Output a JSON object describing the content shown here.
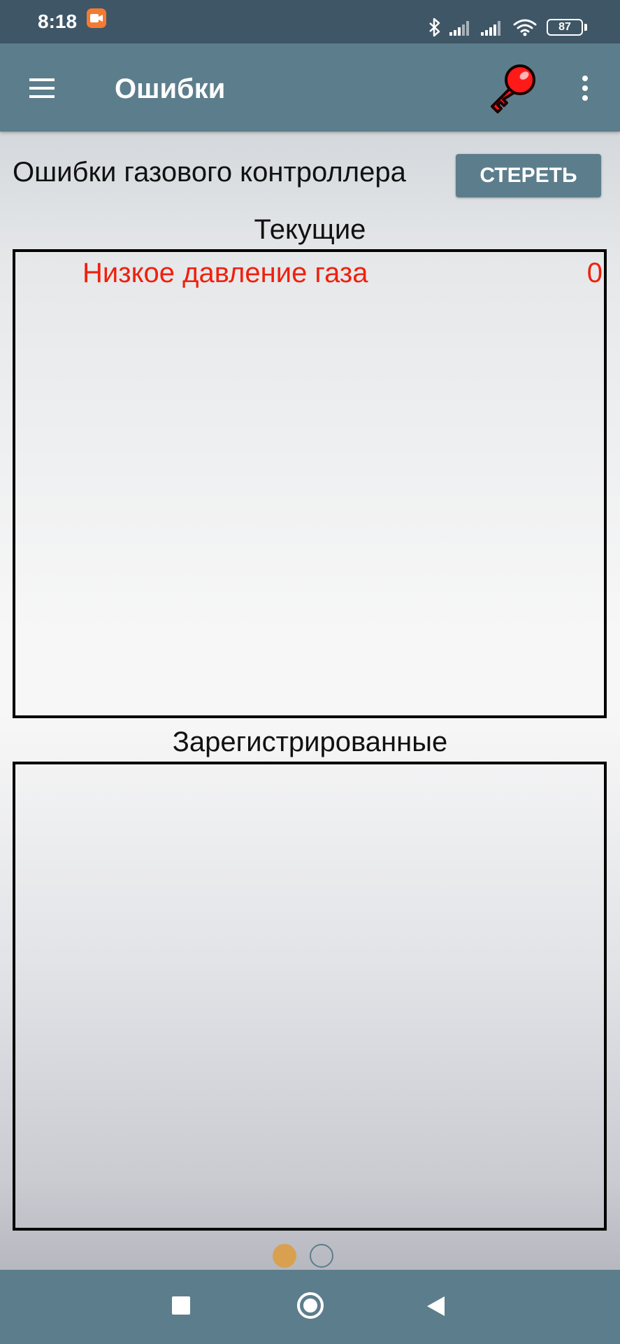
{
  "status_bar": {
    "time": "8:18",
    "battery": "87",
    "icons": [
      "screen-record-icon",
      "bluetooth-icon",
      "signal-1-icon",
      "signal-2-icon",
      "wifi-icon",
      "battery-icon"
    ]
  },
  "app_bar": {
    "title": "Ошибки",
    "icons": [
      "menu-icon",
      "key-icon",
      "more-vert-icon"
    ],
    "key_color": "#ff1a1a"
  },
  "content": {
    "section_title": "Ошибки газового контроллера",
    "clear_button": "СТЕРЕТЬ",
    "current": {
      "label": "Текущие",
      "items": [
        {
          "name": "Низкое давление газа",
          "count": "0"
        }
      ]
    },
    "registered": {
      "label": "Зарегистрированные",
      "items": []
    }
  },
  "pager": {
    "pages": 2,
    "active": 1,
    "active_color": "#d9a050"
  },
  "nav_bar": {
    "icons": [
      "recents-icon",
      "home-icon",
      "back-icon"
    ]
  },
  "colors": {
    "accent": "#5c7d8c",
    "status_bar": "#3f5666",
    "error_text": "#f0200d"
  }
}
